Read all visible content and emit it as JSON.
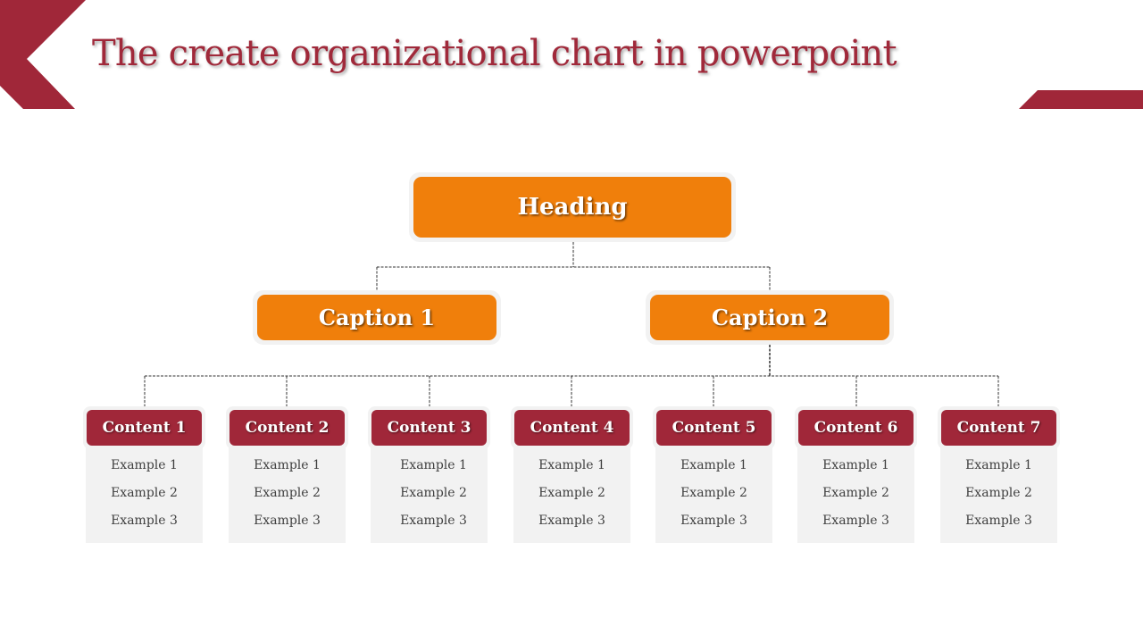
{
  "slide": {
    "title": "The create organizational chart in powerpoint",
    "colors": {
      "accent_red": "#a02739",
      "accent_orange": "#f07f0b",
      "panel_gray": "#f2f2f2",
      "text_gray": "#404040"
    }
  },
  "org_chart": {
    "heading": "Heading",
    "captions": [
      {
        "label": "Caption 1"
      },
      {
        "label": "Caption 2"
      }
    ],
    "contents": [
      {
        "label": "Content 1",
        "items": [
          "Example 1",
          "Example 2",
          "Example 3"
        ]
      },
      {
        "label": "Content 2",
        "items": [
          "Example 1",
          "Example 2",
          "Example 3"
        ]
      },
      {
        "label": "Content 3",
        "items": [
          "Example 1",
          "Example 2",
          "Example 3"
        ]
      },
      {
        "label": "Content 4",
        "items": [
          "Example 1",
          "Example 2",
          "Example 3"
        ]
      },
      {
        "label": "Content 5",
        "items": [
          "Example 1",
          "Example 2",
          "Example 3"
        ]
      },
      {
        "label": "Content 6",
        "items": [
          "Example 1",
          "Example 2",
          "Example 3"
        ]
      },
      {
        "label": "Content 7",
        "items": [
          "Example 1",
          "Example 2",
          "Example 3"
        ]
      }
    ]
  }
}
